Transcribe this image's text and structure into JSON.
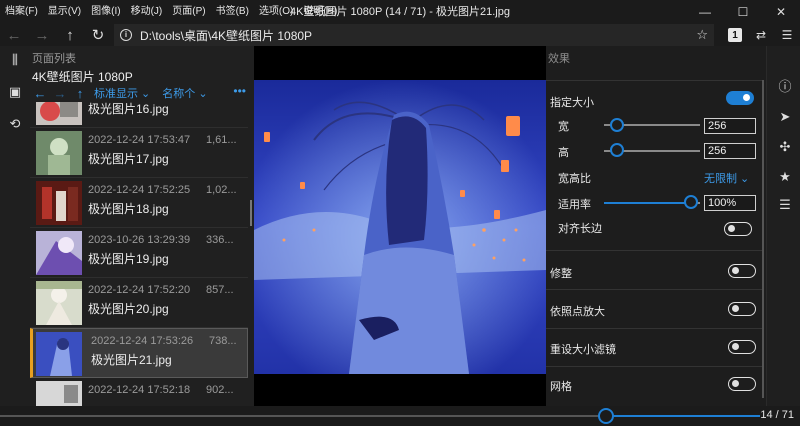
{
  "menu": [
    "档案(F)",
    "显示(V)",
    "图像(I)",
    "移动(J)",
    "页面(P)",
    "书签(B)",
    "选项(O)",
    "说明(H)"
  ],
  "window_title": "4K壁纸图片 1080P (14 / 71) - 极光图片21.jpg",
  "window_controls": {
    "minimize": "—",
    "maximize": "☐",
    "close": "✕"
  },
  "address": {
    "path": "D:\\tools\\桌面\\4K壁纸图片 1080P"
  },
  "nav_right": {
    "page_badge": "1"
  },
  "page_panel": {
    "caption": "页面列表",
    "folder": "4K壁纸图片 1080P",
    "toolbar": {
      "view": "标准显示 ⌄",
      "sort": "名称个 ⌄",
      "more": "•••"
    },
    "items": [
      {
        "date": "",
        "size": "",
        "name": "极光图片16.jpg",
        "selected": false
      },
      {
        "date": "2022-12-24 17:53:47",
        "size": "1,61...",
        "name": "极光图片17.jpg",
        "selected": false
      },
      {
        "date": "2022-12-24 17:52:25",
        "size": "1,02...",
        "name": "极光图片18.jpg",
        "selected": false
      },
      {
        "date": "2023-10-26 13:29:39",
        "size": "336...",
        "name": "极光图片19.jpg",
        "selected": false
      },
      {
        "date": "2022-12-24 17:52:20",
        "size": "857...",
        "name": "极光图片20.jpg",
        "selected": false
      },
      {
        "date": "2022-12-24 17:53:26",
        "size": "738...",
        "name": "极光图片21.jpg",
        "selected": true
      },
      {
        "date": "2022-12-24 17:52:18",
        "size": "902...",
        "name": "",
        "selected": false
      }
    ]
  },
  "effects": {
    "caption": "效果",
    "resize": {
      "label": "指定大小",
      "on": true
    },
    "width": {
      "label": "宽",
      "value": "256"
    },
    "height": {
      "label": "高",
      "value": "256"
    },
    "aspect": {
      "label": "宽高比",
      "value": "无限制 ⌄"
    },
    "ratio": {
      "label": "适用率",
      "value": "100%"
    },
    "align_long": {
      "label": "对齐长边",
      "on": false
    },
    "trim": {
      "label": "修整",
      "on": false
    },
    "point_zoom": {
      "label": "依照点放大",
      "on": false
    },
    "resize_filter": {
      "label": "重设大小滤镜",
      "on": false
    },
    "grid": {
      "label": "网格",
      "on": false
    }
  },
  "bottom": {
    "page_count": "14 / 71",
    "progress": 0.8
  }
}
